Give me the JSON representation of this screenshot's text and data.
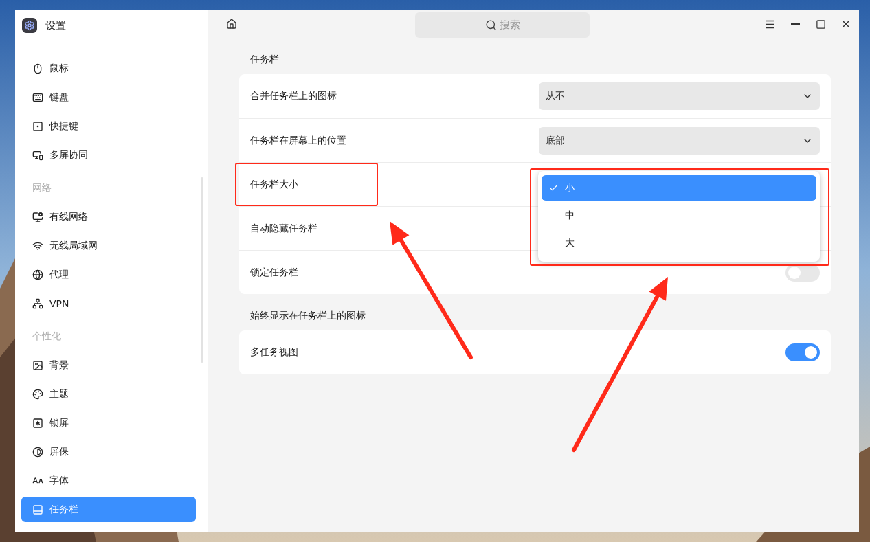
{
  "window": {
    "title": "设置"
  },
  "search": {
    "placeholder": "搜索"
  },
  "sidebar": {
    "items": [
      {
        "kind": "item",
        "label": "鼠标",
        "selected": false
      },
      {
        "kind": "item",
        "label": "键盘",
        "selected": false
      },
      {
        "kind": "item",
        "label": "快捷键",
        "selected": false
      },
      {
        "kind": "item",
        "label": "多屏协同",
        "selected": false
      },
      {
        "kind": "group",
        "label": "网络"
      },
      {
        "kind": "item",
        "label": "有线网络",
        "selected": false
      },
      {
        "kind": "item",
        "label": "无线局域网",
        "selected": false
      },
      {
        "kind": "item",
        "label": "代理",
        "selected": false
      },
      {
        "kind": "item",
        "label": "VPN",
        "selected": false
      },
      {
        "kind": "group",
        "label": "个性化"
      },
      {
        "kind": "item",
        "label": "背景",
        "selected": false
      },
      {
        "kind": "item",
        "label": "主题",
        "selected": false
      },
      {
        "kind": "item",
        "label": "锁屏",
        "selected": false
      },
      {
        "kind": "item",
        "label": "屏保",
        "selected": false
      },
      {
        "kind": "item",
        "label": "字体",
        "selected": false
      },
      {
        "kind": "item",
        "label": "任务栏",
        "selected": true
      }
    ]
  },
  "sections": [
    {
      "title": "任务栏",
      "rows": [
        {
          "kind": "select",
          "label": "合并任务栏上的图标",
          "value": "从不"
        },
        {
          "kind": "select",
          "label": "任务栏在屏幕上的位置",
          "value": "底部"
        },
        {
          "kind": "open_select",
          "label": "任务栏大小",
          "marked": true,
          "popup": {
            "marked": true,
            "options": [
              {
                "label": "小",
                "selected": true
              },
              {
                "label": "中",
                "selected": false
              },
              {
                "label": "大",
                "selected": false
              }
            ]
          }
        },
        {
          "kind": "covered",
          "label": "自动隐藏任务栏"
        },
        {
          "kind": "toggle",
          "label": "锁定任务栏",
          "on": false
        }
      ]
    },
    {
      "title": "始终显示在任务栏上的图标",
      "rows": [
        {
          "kind": "toggle",
          "label": "多任务视图",
          "on": true
        }
      ]
    }
  ]
}
